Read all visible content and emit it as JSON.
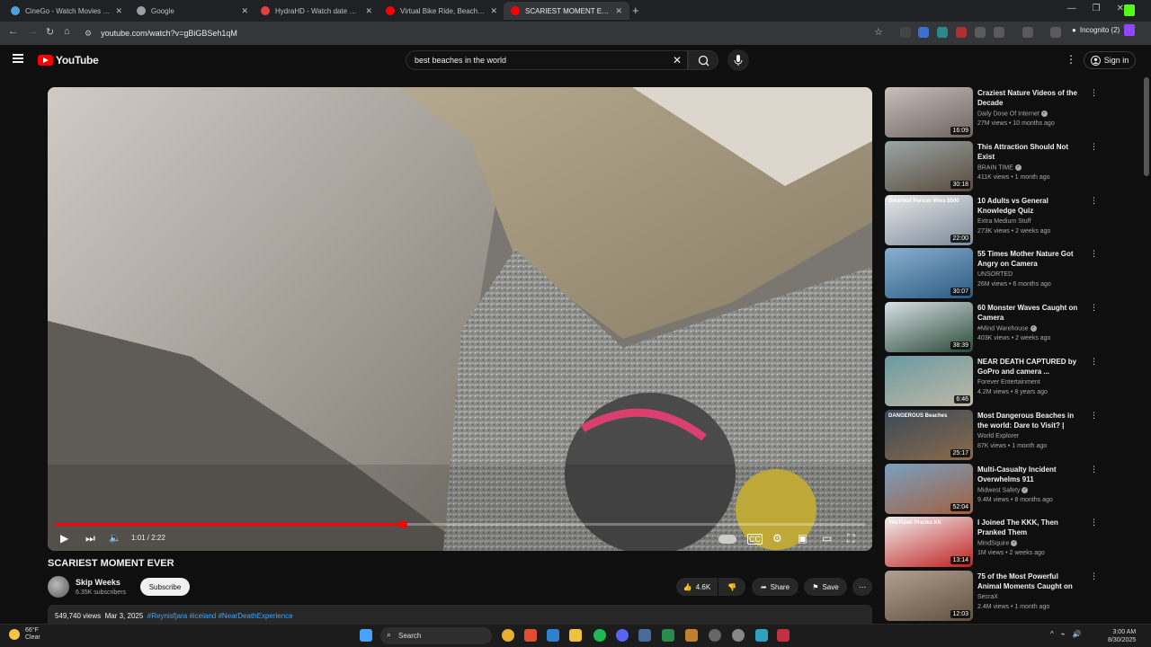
{
  "browser": {
    "tabs": [
      {
        "title": "CineGo - Watch Movies Online",
        "color": "#4aa3df",
        "active": false
      },
      {
        "title": "Google",
        "color": "#9aa0a6",
        "active": false
      },
      {
        "title": "HydraHD - Watch date Movies",
        "color": "#e04040",
        "active": false
      },
      {
        "title": "Virtual Bike Ride, Beach, Gold C",
        "color": "#ff0000",
        "active": false
      },
      {
        "title": "SCARIEST MOMENT EVER - You",
        "color": "#ff0000",
        "active": true
      }
    ],
    "new_tab": "+",
    "url": "youtube.com/watch?v=gBiGBSeh1qM",
    "incognito_label": "Incognito (2)",
    "window_controls": [
      "—",
      "❐",
      "✕"
    ]
  },
  "youtube": {
    "logo_text": "YouTube",
    "search_value": "best beaches in the world",
    "sign_in": "Sign in"
  },
  "player": {
    "time_current": "1:01",
    "time_total": "2:22",
    "time_readout": "1:01 / 2:22",
    "progress_fraction": 0.43
  },
  "video": {
    "title": "SCARIEST MOMENT EVER",
    "channel": "Skip Weeks",
    "subscribers": "6.35K subscribers",
    "subscribe_label": "Subscribe",
    "likes": "4.6K",
    "share_label": "Share",
    "save_label": "Save",
    "views": "549,740 views",
    "date": "Mar 3, 2025",
    "tags": "#Reynisfjara #iceland #NearDeathExperience"
  },
  "recommendations": [
    {
      "title": "Craziest Nature Videos of the Decade",
      "channel": "Daily Dose Of Internet",
      "verified": true,
      "meta": "27M views • 10 months ago",
      "duration": "16:09",
      "thumb": [
        "#c8c0bc",
        "#6d6260"
      ],
      "overlay": ""
    },
    {
      "title": "This Attraction Should Not Exist",
      "channel": "BRAIN TIME",
      "verified": true,
      "meta": "411K views • 1 month ago",
      "duration": "30:18",
      "thumb": [
        "#9aa6a8",
        "#5a4a3a"
      ],
      "overlay": ""
    },
    {
      "title": "10 Adults vs General Knowledge Quiz",
      "channel": "Extra Medium Stuff",
      "verified": false,
      "meta": "273K views • 2 weeks ago",
      "duration": "22:00",
      "thumb": [
        "#e8e8e8",
        "#7a8a9a"
      ],
      "overlay": "Smartest Person Wins $500"
    },
    {
      "title": "55 Times Mother Nature Got Angry on Camera",
      "channel": "UNSORTED",
      "verified": false,
      "meta": "26M views • 6 months ago",
      "duration": "30:07",
      "thumb": [
        "#8ab0d0",
        "#2a5a80"
      ],
      "overlay": ""
    },
    {
      "title": "60 Monster Waves Caught on Camera",
      "channel": "#Mind Warehouse",
      "verified": true,
      "meta": "403K views • 2 weeks ago",
      "duration": "38:39",
      "thumb": [
        "#d8e0e4",
        "#2a4a3a"
      ],
      "overlay": ""
    },
    {
      "title": "NEAR DEATH CAPTURED by GoPro and camera ...",
      "channel": "Forever Entertainment",
      "verified": false,
      "meta": "4.2M views • 8 years ago",
      "duration": "6:46",
      "thumb": [
        "#6a9aa0",
        "#c0b8a8"
      ],
      "overlay": ""
    },
    {
      "title": "Most Dangerous Beaches in the world: Dare to Visit? | World ...",
      "channel": "World Explorer",
      "verified": false,
      "meta": "87K views • 1 month ago",
      "duration": "25:17",
      "thumb": [
        "#3a4a5a",
        "#8a6a4a"
      ],
      "overlay": "DANGEROUS Beaches"
    },
    {
      "title": "Multi-Casualty Incident Overwhelms 911",
      "channel": "Midwest Safety",
      "verified": true,
      "meta": "9.4M views • 8 months ago",
      "duration": "52:04",
      "thumb": [
        "#7aa0c0",
        "#a06040"
      ],
      "overlay": ""
    },
    {
      "title": "I Joined The KKK, Then Pranked Them",
      "channel": "MindSquire",
      "verified": true,
      "meta": "1M views • 2 weeks ago",
      "duration": "13:14",
      "thumb": [
        "#f0f0f0",
        "#c02020"
      ],
      "overlay": "YouTuber Pranks KK"
    },
    {
      "title": "75 of the Most Powerful Animal Moments Caught on Camera",
      "channel": "SecraX",
      "verified": false,
      "meta": "2.4M views • 1 month ago",
      "duration": "12:03",
      "thumb": [
        "#b0a090",
        "#605040"
      ],
      "overlay": ""
    }
  ],
  "taskbar": {
    "temp": "66°F",
    "weather": "Clear",
    "search_label": "Search",
    "time": "3:00 AM",
    "date": "8/30/2025"
  }
}
